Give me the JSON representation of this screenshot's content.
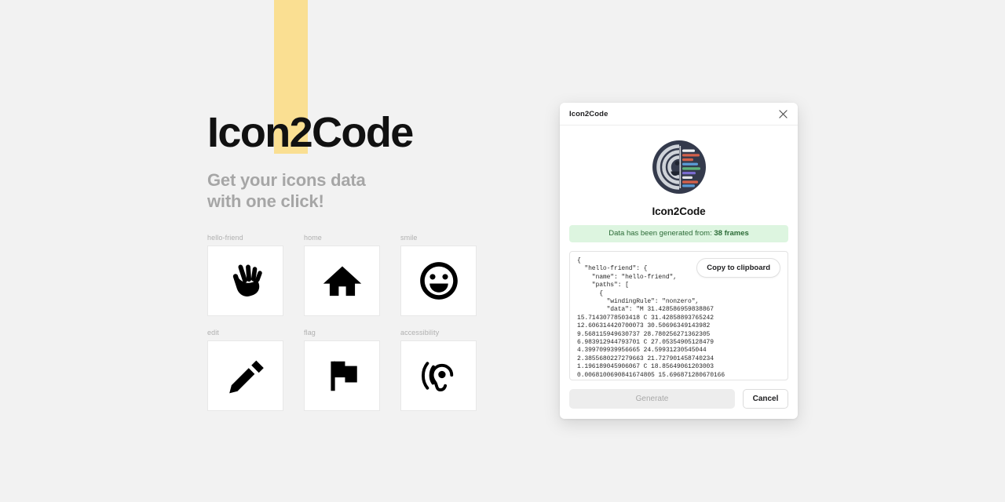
{
  "page": {
    "background_color": "#f2f2f2",
    "highlight_color": "#fadf92"
  },
  "hero": {
    "title": "Icon2Code",
    "subtitle_line1": "Get your icons data",
    "subtitle_line2": "with one click!"
  },
  "icon_grid": {
    "items": [
      {
        "label": "hello-friend",
        "icon": "waving-hand-icon"
      },
      {
        "label": "home",
        "icon": "home-icon"
      },
      {
        "label": "smile",
        "icon": "smiley-face-icon"
      },
      {
        "label": "edit",
        "icon": "pencil-icon"
      },
      {
        "label": "flag",
        "icon": "flag-icon"
      },
      {
        "label": "accessibility",
        "icon": "ear-hearing-icon"
      }
    ]
  },
  "dialog": {
    "window_title": "Icon2Code",
    "close_icon": "close-icon",
    "logo_icon": "icon2code-logo",
    "app_name": "Icon2Code",
    "status_prefix": "Data has been generated from: ",
    "status_value": "38 frames",
    "status_bg_color": "#ddf5e0",
    "status_text_color": "#2c6b37",
    "copy_button_label": "Copy to clipboard",
    "code": "{\n  \"hello-friend\": {\n    \"name\": \"hello-friend\",\n    \"paths\": [\n      {\n        \"windingRule\": \"nonzero\",\n        \"data\": \"M 31.428586959838867\n15.71430778503418 C 31.42858893765242\n12.606314420700073 30.50696349143982\n9.568115949630737 28.780256271362305\n6.983912944793701 C 27.05354905128479\n4.399709939956665 24.59931230545044\n2.3855680227279663 21.727901458740234\n1.196189045906067 C 18.85649061203003\n0.0068100690841674805 15.696871280670166"
  },
  "footer": {
    "generate_label": "Generate",
    "cancel_label": "Cancel"
  }
}
